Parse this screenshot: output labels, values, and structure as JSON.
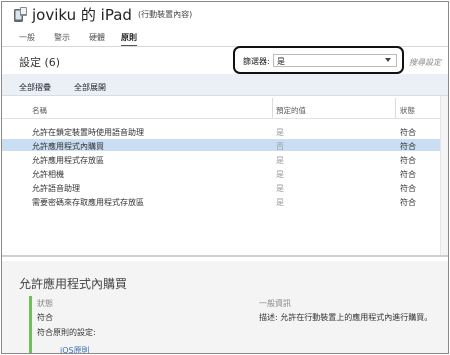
{
  "header": {
    "title": "joviku 的 iPad",
    "subtitle": "(行動裝置內容)",
    "icon": "ipad-device-icon"
  },
  "tabs": [
    {
      "label": "一般",
      "active": false
    },
    {
      "label": "警示",
      "active": false
    },
    {
      "label": "硬體",
      "active": false
    },
    {
      "label": "原則",
      "active": true
    }
  ],
  "settings": {
    "title": "設定 (6)",
    "filter_label": "篩選器:",
    "filter_value": "是",
    "search_label": "搜尋設定"
  },
  "toolbar": {
    "collapse_all": "全部摺疊",
    "expand_all": "全部展開"
  },
  "table": {
    "columns": [
      "名稱",
      "預定的值",
      "狀態"
    ],
    "rows": [
      {
        "name": "允許在鎖定裝置時使用語音助理",
        "default": "是",
        "status": "符合",
        "selected": false
      },
      {
        "name": "允許應用程式內購買",
        "default": "否",
        "status": "符合",
        "selected": true
      },
      {
        "name": "允許應用程式存放區",
        "default": "是",
        "status": "符合",
        "selected": false
      },
      {
        "name": "允許相機",
        "default": "是",
        "status": "符合",
        "selected": false
      },
      {
        "name": "允許語音助理",
        "default": "是",
        "status": "符合",
        "selected": false
      },
      {
        "name": "需要密碼來存取應用程式存放區",
        "default": "是",
        "status": "符合",
        "selected": false
      }
    ]
  },
  "details": {
    "title": "允許應用程式內購買",
    "status_label": "狀態",
    "status_value": "符合",
    "rule_label": "符合原則的設定:",
    "rule_link": "iOS原則",
    "general_label": "一般資訊",
    "description": "描述: 允許在行動裝置上的應用程式內進行購買。"
  },
  "colors": {
    "selected_row": "#c9def3",
    "toolbar_bg": "#eaf0f5",
    "status_accent": "#6fbf5a",
    "link": "#3b6fb0"
  }
}
